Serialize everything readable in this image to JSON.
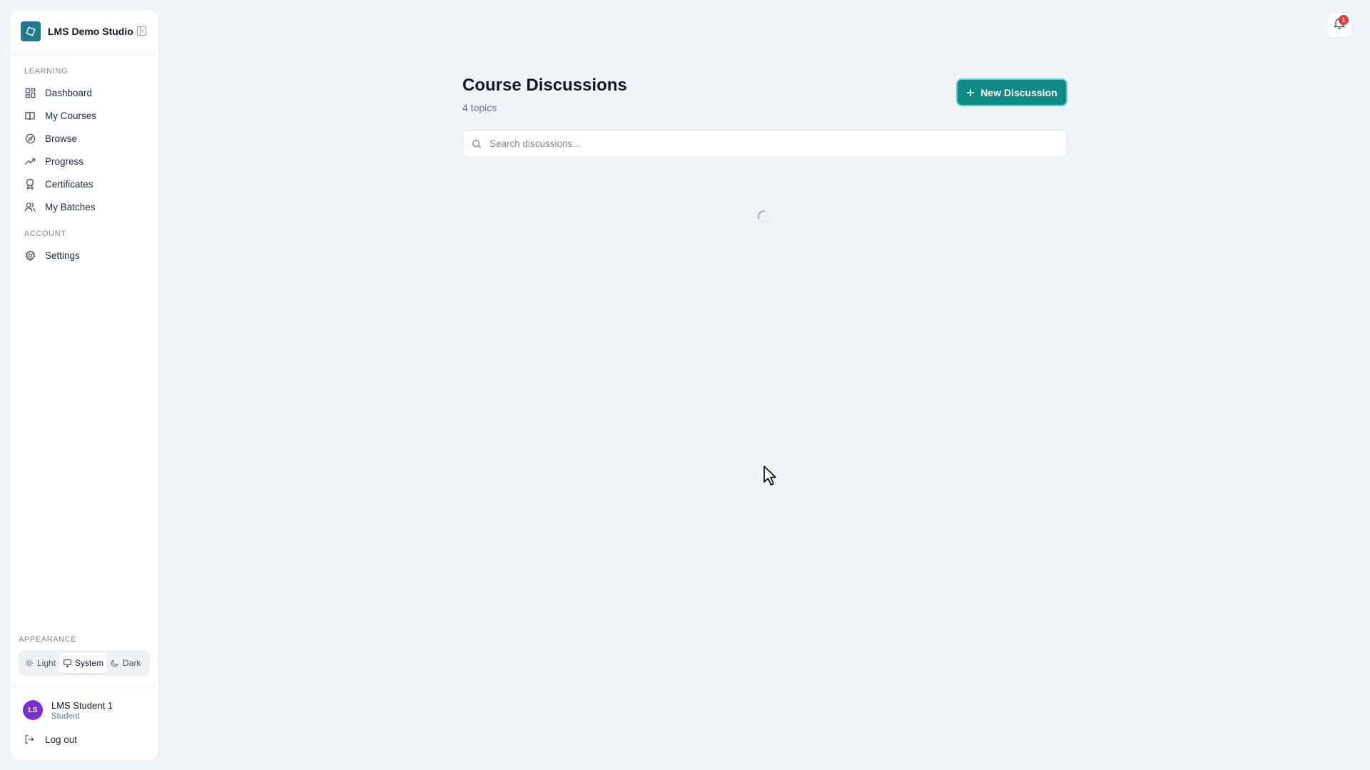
{
  "brand": {
    "name": "LMS Demo Studio"
  },
  "sidebar": {
    "sections": [
      {
        "label": "Learning",
        "items": [
          {
            "label": "Dashboard",
            "icon": "dashboard-icon"
          },
          {
            "label": "My Courses",
            "icon": "book-icon"
          },
          {
            "label": "Browse",
            "icon": "compass-icon"
          },
          {
            "label": "Progress",
            "icon": "trending-up-icon"
          },
          {
            "label": "Certificates",
            "icon": "award-icon"
          },
          {
            "label": "My Batches",
            "icon": "users-icon"
          }
        ]
      },
      {
        "label": "Account",
        "items": [
          {
            "label": "Settings",
            "icon": "gear-icon"
          }
        ]
      }
    ],
    "appearance": {
      "label": "Appearance",
      "options": [
        {
          "label": "Light",
          "icon": "sun-icon"
        },
        {
          "label": "System",
          "icon": "monitor-icon"
        },
        {
          "label": "Dark",
          "icon": "moon-icon"
        }
      ],
      "selected": "System"
    },
    "user": {
      "initials": "LS",
      "name": "LMS Student 1",
      "role": "Student"
    },
    "logout_label": "Log out"
  },
  "main": {
    "title": "Course Discussions",
    "subtitle": "4 topics",
    "new_button_label": "New Discussion",
    "search_placeholder": "Search discussions..."
  },
  "notifications": {
    "count": "1"
  },
  "colors": {
    "accent": "#0f8a84",
    "brand_logo": "#1d7a8f",
    "avatar": "#7a2fd0",
    "badge": "#e53935",
    "background": "#f0f4f8"
  }
}
